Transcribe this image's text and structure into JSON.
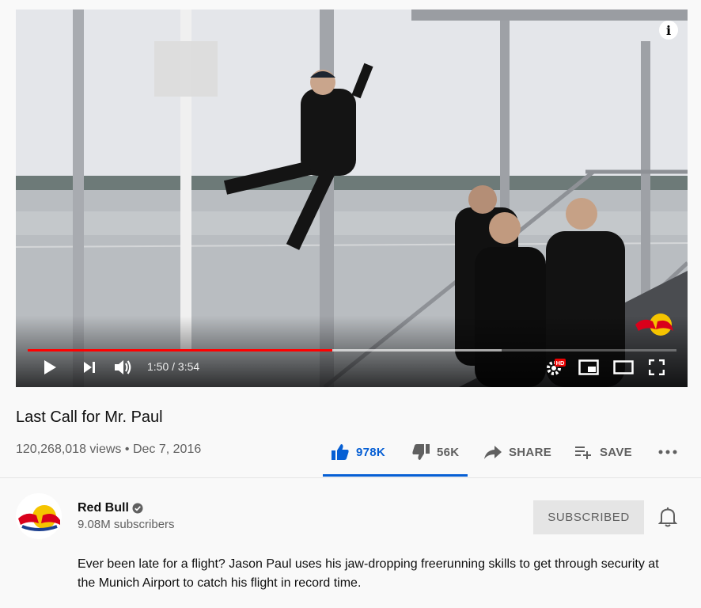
{
  "player": {
    "current_time": "1:50",
    "duration": "3:54",
    "time_display": "1:50 / 3:54",
    "played_fraction": 0.47,
    "buffered_fraction": 0.73,
    "hd_badge": "HD",
    "info_label": "i",
    "accent": "#ff0000"
  },
  "video": {
    "title": "Last Call for Mr. Paul",
    "views": "120,268,018 views",
    "separator": "•",
    "date": "Dec 7, 2016"
  },
  "actions": {
    "like_count": "978K",
    "dislike_count": "56K",
    "share_label": "SHARE",
    "save_label": "SAVE",
    "like_ratio": 1.0
  },
  "channel": {
    "name": "Red Bull",
    "subscribers": "9.08M subscribers",
    "subscribe_label": "SUBSCRIBED"
  },
  "description": "Ever been late for a flight? Jason Paul uses his jaw-dropping freerunning skills to get through security at the Munich Airport to catch his flight in record time.",
  "colors": {
    "link_blue": "#065fd4",
    "text_secondary": "#606060",
    "button_grey": "#e5e5e5"
  },
  "icons": [
    "play-icon",
    "next-icon",
    "volume-icon",
    "settings-icon",
    "miniplayer-icon",
    "theater-icon",
    "fullscreen-icon",
    "info-icon",
    "thumb-up-icon",
    "thumb-down-icon",
    "share-icon",
    "playlist-add-icon",
    "more-icon",
    "verified-icon",
    "bell-icon"
  ]
}
